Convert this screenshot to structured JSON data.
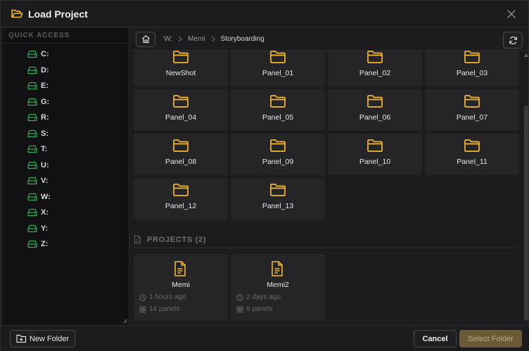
{
  "dialog": {
    "title": "Load Project"
  },
  "sidebar": {
    "header": "QUICK ACCESS",
    "drives": [
      "C:",
      "D:",
      "E:",
      "G:",
      "R:",
      "S:",
      "T:",
      "U:",
      "V:",
      "W:",
      "X:",
      "Y:",
      "Z:"
    ]
  },
  "breadcrumb": {
    "items": [
      "W:",
      "Memi",
      "Storyboarding"
    ]
  },
  "folders": [
    "NewShot",
    "Panel_01",
    "Panel_02",
    "Panel_03",
    "Panel_04",
    "Panel_05",
    "Panel_06",
    "Panel_07",
    "Panel_08",
    "Panel_09",
    "Panel_10",
    "Panel_11",
    "Panel_12",
    "Panel_13"
  ],
  "projects": {
    "header": "PROJECTS (2)",
    "items": [
      {
        "name": "Memi",
        "time": "1 hours ago",
        "panels": "14 panels"
      },
      {
        "name": "Memi2",
        "time": "2 days ago",
        "panels": "6 panels"
      }
    ]
  },
  "footer": {
    "new_folder_label": "New Folder",
    "cancel_label": "Cancel",
    "select_label": "Select Folder"
  },
  "colors": {
    "accent_folder": "#f5b82e",
    "drive_icon": "#2fae5a",
    "select_button_bg": "#6b5a36",
    "background": "#1c1c1e"
  }
}
